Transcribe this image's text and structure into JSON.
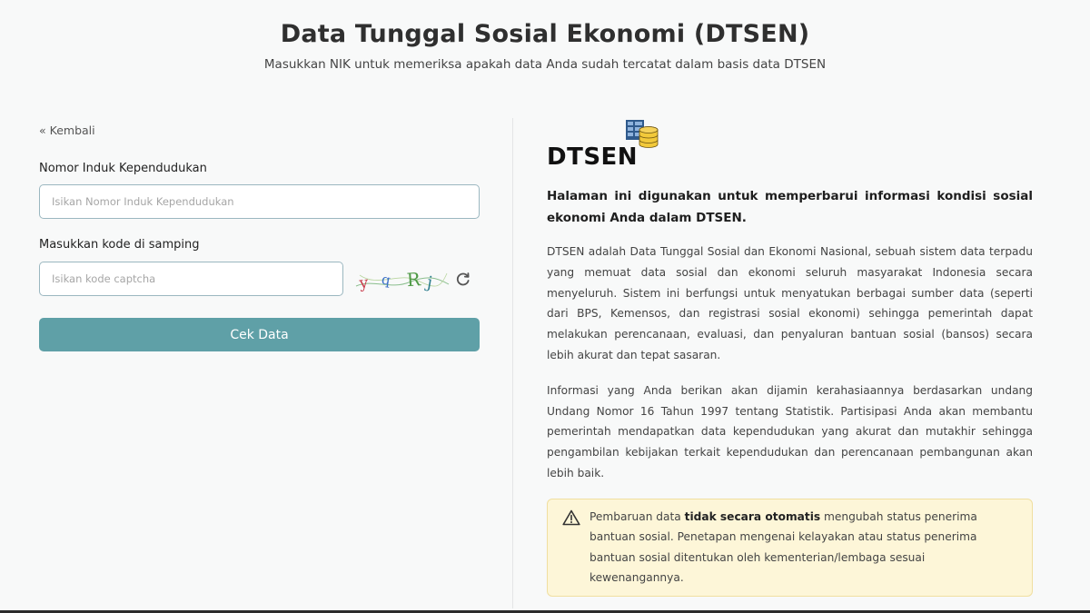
{
  "header": {
    "title": "Data Tunggal Sosial Ekonomi (DTSEN)",
    "subtitle": "Masukkan NIK untuk memeriksa apakah data Anda sudah tercatat dalam basis data DTSEN"
  },
  "form": {
    "back_label": "« Kembali",
    "nik_label": "Nomor Induk Kependudukan",
    "nik_placeholder": "Isikan Nomor Induk Kependudukan",
    "nik_value": "",
    "captcha_label": "Masukkan kode di samping",
    "captcha_placeholder": "Isikan kode captcha",
    "captcha_value": "",
    "captcha_code": "yqRj",
    "submit_label": "Cek Data"
  },
  "info": {
    "brand": "DTSEN",
    "lead": "Halaman ini digunakan untuk memperbarui informasi kondisi sosial ekonomi Anda dalam DTSEN.",
    "paragraph_1": "DTSEN adalah Data Tunggal Sosial dan Ekonomi Nasional, sebuah sistem data terpadu yang memuat data sosial dan ekonomi seluruh masyarakat Indonesia secara menyeluruh. Sistem ini berfungsi untuk menyatukan berbagai sumber data (seperti dari BPS, Kemensos, dan registrasi sosial ekonomi) sehingga pemerintah dapat melakukan perencanaan, evaluasi, dan penyaluran bantuan sosial (bansos) secara lebih akurat dan tepat sasaran.",
    "paragraph_2": "Informasi yang Anda berikan akan dijamin kerahasiaannya berdasarkan undang Undang Nomor 16 Tahun 1997 tentang Statistik. Partisipasi Anda akan membantu pemerintah mendapatkan data kependudukan yang akurat dan mutakhir sehingga pengambilan kebijakan terkait kependudukan dan perencanaan pembangunan akan lebih baik.",
    "notice": {
      "prefix": "Pembaruan data ",
      "emphasis": "tidak secara otomatis",
      "suffix": " mengubah status penerima bantuan sosial. Penetapan mengenai kelayakan atau status penerima bantuan sosial ditentukan oleh kementerian/lembaga sesuai kewenangannya."
    }
  },
  "icons": {
    "brand": "database-icon",
    "refresh": "refresh-icon",
    "warning": "warning-triangle-icon"
  },
  "colors": {
    "accent": "#5fa0a7",
    "notice_bg": "#fdf6d8",
    "notice_border": "#f0dfa0",
    "input_border": "#9bb7c0"
  }
}
